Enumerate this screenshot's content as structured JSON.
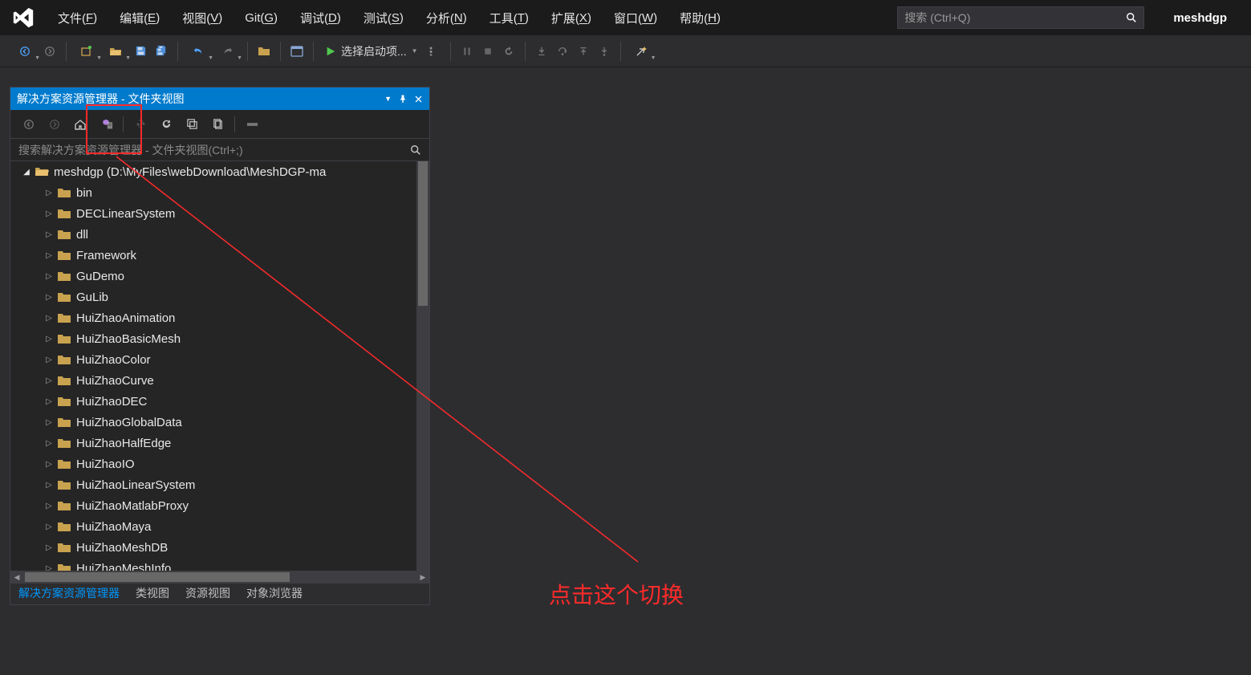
{
  "menubar": {
    "items": [
      {
        "pre": "文件(",
        "u": "F",
        "post": ")"
      },
      {
        "pre": "编辑(",
        "u": "E",
        "post": ")"
      },
      {
        "pre": "视图(",
        "u": "V",
        "post": ")"
      },
      {
        "pre": "Git(",
        "u": "G",
        "post": ")"
      },
      {
        "pre": "调试(",
        "u": "D",
        "post": ")"
      },
      {
        "pre": "测试(",
        "u": "S",
        "post": ")"
      },
      {
        "pre": "分析(",
        "u": "N",
        "post": ")"
      },
      {
        "pre": "工具(",
        "u": "T",
        "post": ")"
      },
      {
        "pre": "扩展(",
        "u": "X",
        "post": ")"
      },
      {
        "pre": "窗口(",
        "u": "W",
        "post": ")"
      },
      {
        "pre": "帮助(",
        "u": "H",
        "post": ")"
      }
    ],
    "search_placeholder": "搜索 (Ctrl+Q)",
    "username": "meshdgp"
  },
  "toolbar": {
    "start_label": "选择启动项..."
  },
  "panel": {
    "title": "解决方案资源管理器 - 文件夹视图",
    "search_placeholder": "搜索解决方案资源管理器 - 文件夹视图(Ctrl+;)",
    "root": "meshdgp (D:\\MyFiles\\webDownload\\MeshDGP-ma",
    "folders": [
      "bin",
      "DECLinearSystem",
      "dll",
      "Framework",
      "GuDemo",
      "GuLib",
      "HuiZhaoAnimation",
      "HuiZhaoBasicMesh",
      "HuiZhaoColor",
      "HuiZhaoCurve",
      "HuiZhaoDEC",
      "HuiZhaoGlobalData",
      "HuiZhaoHalfEdge",
      "HuiZhaoIO",
      "HuiZhaoLinearSystem",
      "HuiZhaoMatlabProxy",
      "HuiZhaoMaya",
      "HuiZhaoMeshDB",
      "HuiZhaoMeshInfo"
    ]
  },
  "bottom_tabs": [
    "解决方案资源管理器",
    "类视图",
    "资源视图",
    "对象浏览器"
  ],
  "annotation": "点击这个切换"
}
